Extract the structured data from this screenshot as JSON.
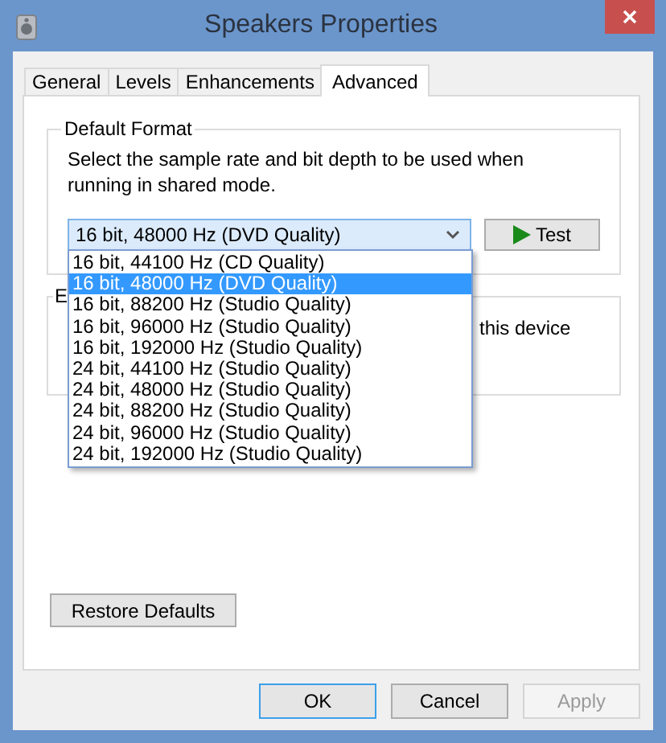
{
  "window": {
    "title": "Speakers Properties"
  },
  "tabs": [
    {
      "label": "General",
      "selected": false
    },
    {
      "label": "Levels",
      "selected": false
    },
    {
      "label": "Enhancements",
      "selected": false
    },
    {
      "label": "Advanced",
      "selected": true
    }
  ],
  "default_format": {
    "label": "Default Format",
    "description": "Select the sample rate and bit depth to be used when running in shared mode.",
    "format_dropdown": {
      "value": "16 bit, 48000 Hz (DVD Quality)",
      "expanded": true,
      "options": [
        {
          "label": "16 bit, 44100 Hz (CD Quality)",
          "selected": false
        },
        {
          "label": "16 bit, 48000 Hz (DVD Quality)",
          "selected": true
        },
        {
          "label": "16 bit, 88200 Hz (Studio Quality)",
          "selected": false
        },
        {
          "label": "16 bit, 96000 Hz (Studio Quality)",
          "selected": false
        },
        {
          "label": "16 bit, 192000 Hz (Studio Quality)",
          "selected": false
        },
        {
          "label": "24 bit, 44100 Hz (Studio Quality)",
          "selected": false
        },
        {
          "label": "24 bit, 48000 Hz (Studio Quality)",
          "selected": false
        },
        {
          "label": "24 bit, 88200 Hz (Studio Quality)",
          "selected": false
        },
        {
          "label": "24 bit, 96000 Hz (Studio Quality)",
          "selected": false
        },
        {
          "label": "24 bit, 192000 Hz (Studio Quality)",
          "selected": false
        }
      ]
    },
    "test_button": "Test"
  },
  "exclusive_mode": {
    "label": "E",
    "text": "this device"
  },
  "restore_button": "Restore Defaults",
  "buttons": [
    {
      "label": "OK",
      "default": true,
      "disabled": false
    },
    {
      "label": "Cancel",
      "default": false,
      "disabled": false
    },
    {
      "label": "Apply",
      "default": false,
      "disabled": true
    }
  ]
}
